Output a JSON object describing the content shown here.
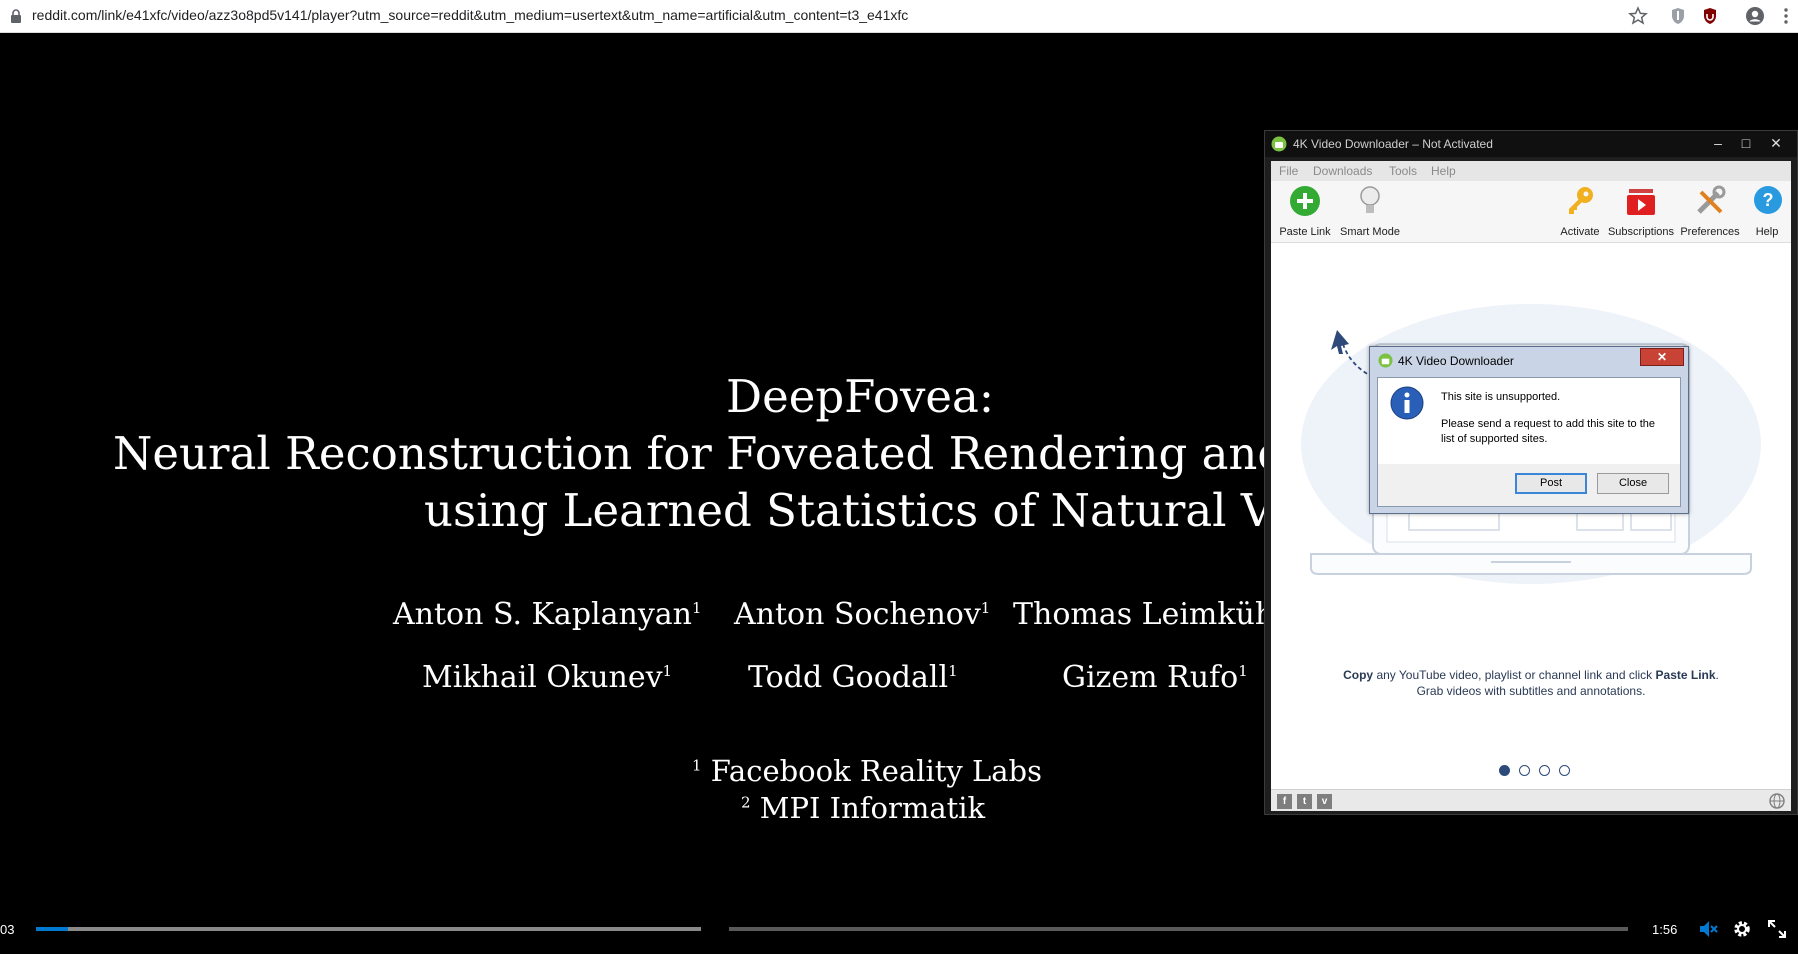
{
  "browser": {
    "url": "reddit.com/link/e41xfc/video/azz3o8pd5v141/player?utm_source=reddit&utm_medium=usertext&utm_name=artificial&utm_content=t3_e41xfc"
  },
  "slide": {
    "title_line1": "DeepFovea:",
    "title_line2": "Neural Reconstruction for Foveated Rendering and Vide",
    "title_line3": "using Learned Statistics of Natural Videos",
    "authors_row1": [
      "Anton S. Kaplanyan",
      "Anton Sochenov",
      "Thomas Leimkühle"
    ],
    "authors_row2": [
      "Mikhail Okunev",
      "Todd Goodall",
      "Gizem Rufo"
    ],
    "author_mark": "1",
    "aff1_mark": "1",
    "aff1": "Facebook Reality Labs",
    "aff2_mark": "2",
    "aff2": "MPI Informatik"
  },
  "player": {
    "current_time": "03",
    "duration": "1:56",
    "played_fraction": 0.02,
    "buffered_fraction": 0.42
  },
  "app": {
    "title": "4K Video Downloader – Not Activated",
    "menu": [
      "File",
      "Downloads",
      "Tools",
      "Help"
    ],
    "toolbar": {
      "paste_link": "Paste Link",
      "smart_mode": "Smart Mode",
      "activate": "Activate",
      "subscriptions": "Subscriptions",
      "preferences": "Preferences",
      "help": "Help"
    },
    "hint_copy": "Copy",
    "hint_middle": " any YouTube video, playlist or channel link and click ",
    "hint_paste": "Paste Link",
    "hint_end": ".",
    "hint_line2": "Grab videos with subtitles and annotations.",
    "accent": "#2d4a7a"
  },
  "dialog": {
    "title": "4K Video Downloader",
    "message": "This site is unsupported.",
    "detail": "Please send a request to add this site to the list of supported sites.",
    "post_label": "Post",
    "close_label": "Close"
  }
}
